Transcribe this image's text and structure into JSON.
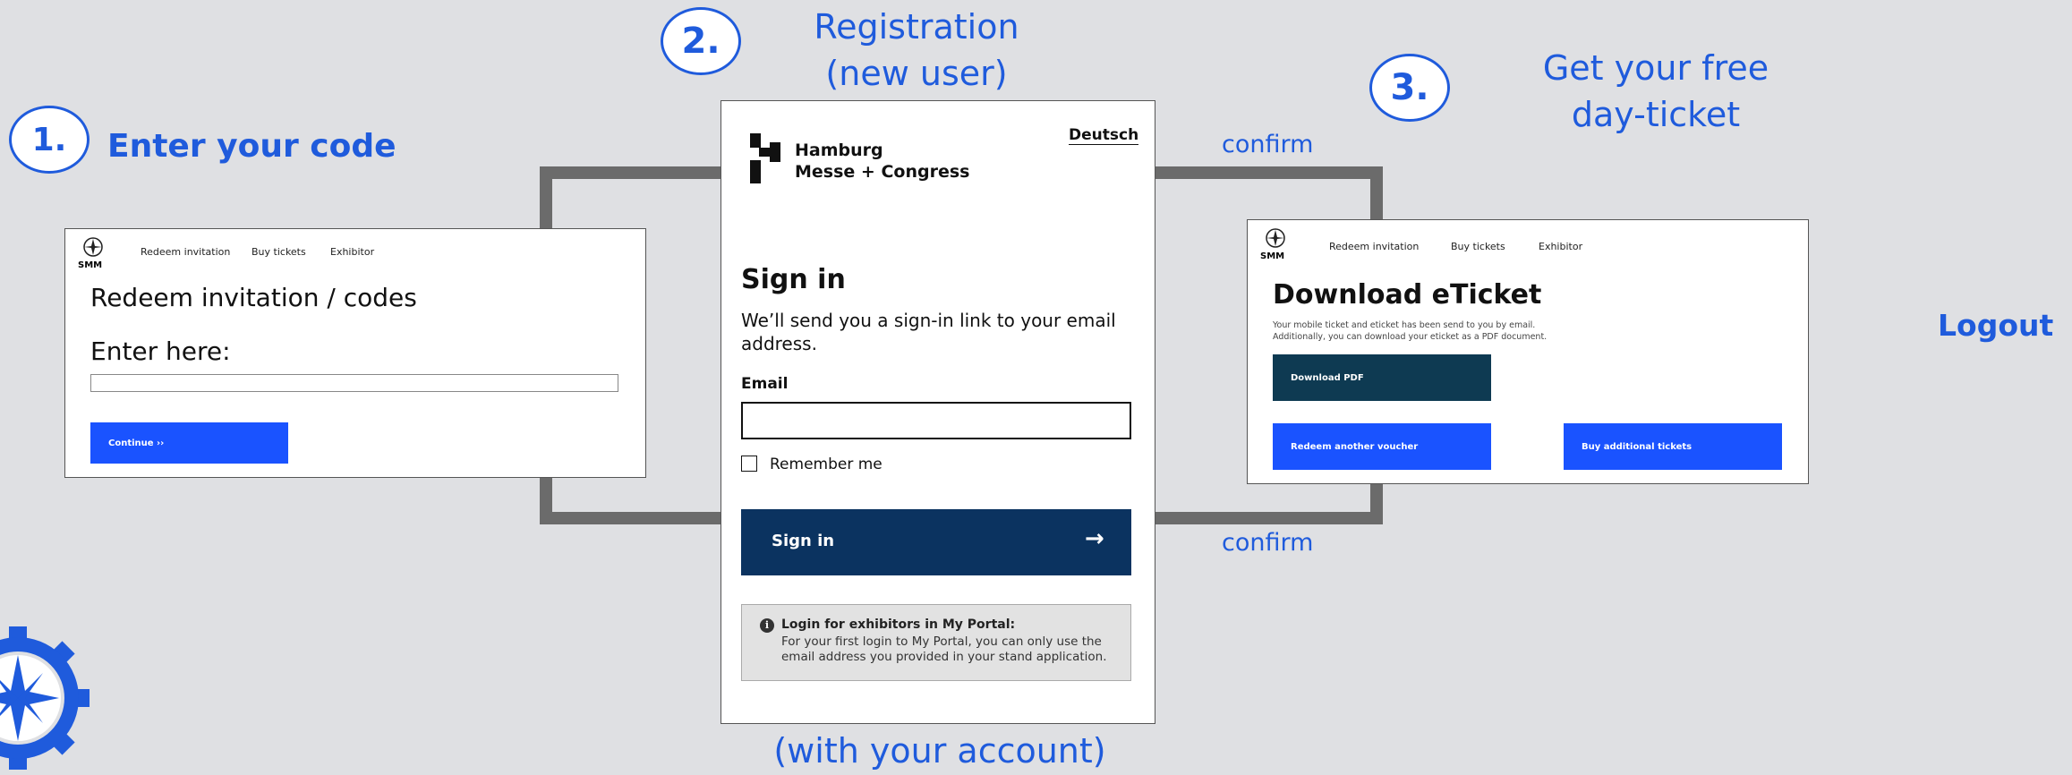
{
  "step1": {
    "number": "1.",
    "heading": "Enter your code",
    "nav": {
      "logo": "SMM",
      "items": [
        "Redeem invitation",
        "Buy tickets",
        "Exhibitor"
      ]
    },
    "title": "Redeem invitation / codes",
    "subtitle": "Enter here:",
    "input_value": "",
    "continue_label": "Continue ››"
  },
  "step2": {
    "number": "2.",
    "heading_line1": "Registration",
    "heading_line2": "(new user)",
    "footer": "(with your account)",
    "language": "Deutsch",
    "brand_line1": "Hamburg",
    "brand_line2": "Messe + Congress",
    "title": "Sign in",
    "description": "We’ll send you a sign-in link to your email address.",
    "email_label": "Email",
    "email_value": "",
    "remember_label": "Remember me",
    "signin_label": "Sign in",
    "signin_arrow": "→",
    "info_title": "Login for exhibitors in My Portal:",
    "info_text": "For your first login to My Portal, you can only use the email address you provided in your stand application."
  },
  "step3": {
    "number": "3.",
    "heading_line1": "Get your free",
    "heading_line2": "day-ticket",
    "nav": {
      "logo": "SMM",
      "items": [
        "Redeem invitation",
        "Buy tickets",
        "Exhibitor"
      ]
    },
    "title": "Download eTicket",
    "description_line1": "Your mobile ticket and eticket has been send to you by email.",
    "description_line2": "Additionally, you can download your eticket as a PDF document.",
    "download_label": "Download PDF",
    "redeem_label": "Redeem another voucher",
    "buy_label": "Buy additional tickets"
  },
  "connectors": {
    "confirm_top": "confirm",
    "confirm_bottom": "confirm"
  },
  "logout": "Logout",
  "colors": {
    "accent": "#1f5bdc",
    "button_blue": "#1a53ff",
    "button_dark": "#0e3a52",
    "signin_navy": "#0b3360"
  }
}
